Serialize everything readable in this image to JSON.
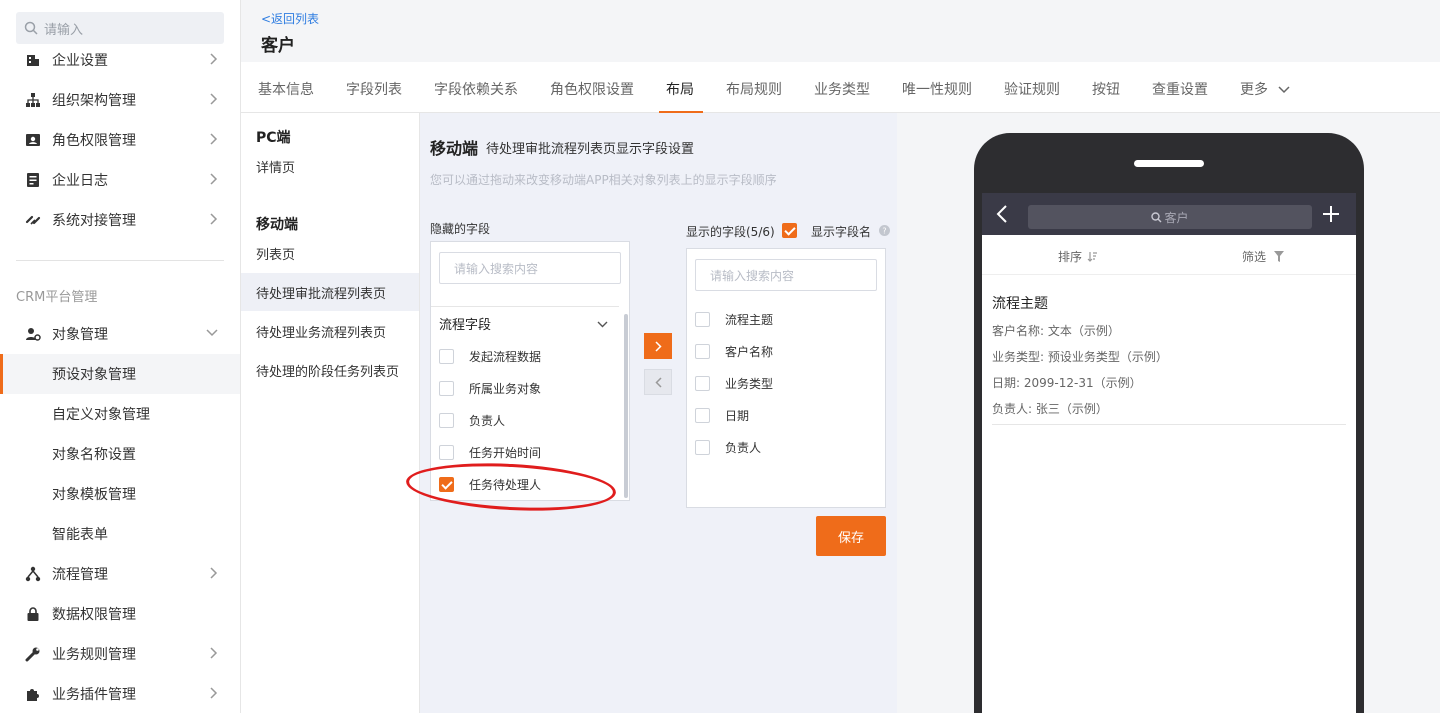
{
  "sidebar": {
    "search_placeholder": "请输入",
    "items_top": [
      {
        "label": "企业设置",
        "icon": "building-icon"
      },
      {
        "label": "组织架构管理",
        "icon": "org-chart-icon"
      },
      {
        "label": "角色权限管理",
        "icon": "id-card-icon"
      },
      {
        "label": "企业日志",
        "icon": "log-icon"
      },
      {
        "label": "系统对接管理",
        "icon": "link-icon"
      }
    ],
    "section_label": "CRM平台管理",
    "object_mgmt": "对象管理",
    "sub_items": [
      "预设对象管理",
      "自定义对象管理",
      "对象名称设置",
      "对象模板管理",
      "智能表单"
    ],
    "items_bottom": [
      {
        "label": "流程管理",
        "icon": "flow-icon"
      },
      {
        "label": "数据权限管理",
        "icon": "lock-icon"
      },
      {
        "label": "业务规则管理",
        "icon": "wrench-icon"
      },
      {
        "label": "业务插件管理",
        "icon": "puzzle-icon"
      }
    ]
  },
  "header": {
    "back_link": "<返回列表",
    "title": "客户"
  },
  "tabs": [
    "基本信息",
    "字段列表",
    "字段依赖关系",
    "角色权限设置",
    "布局",
    "布局规则",
    "业务类型",
    "唯一性规则",
    "验证规则",
    "按钮",
    "查重设置",
    "更多"
  ],
  "active_tab": "布局",
  "subnav": {
    "pc_title": "PC端",
    "pc_items": [
      "详情页"
    ],
    "mobile_title": "移动端",
    "mobile_items": [
      "列表页",
      "待处理审批流程列表页",
      "待处理业务流程列表页",
      "待处理的阶段任务列表页"
    ]
  },
  "config": {
    "title": "移动端",
    "subtitle": "待处理审批流程列表页显示字段设置",
    "hint": "您可以通过拖动来改变移动端APP相关对象列表上的显示字段顺序",
    "hidden_label": "隐藏的字段",
    "shown_label": "显示的字段(5/6)",
    "shown_name_label": "显示字段名",
    "search_placeholder": "请输入搜索内容",
    "group_label": "流程字段",
    "hidden_fields": [
      "发起流程数据",
      "所属业务对象",
      "负责人",
      "任务开始时间",
      "任务待处理人"
    ],
    "shown_fields": [
      "流程主题",
      "客户名称",
      "业务类型",
      "日期",
      "负责人"
    ],
    "save_label": "保存",
    "accent": "#ef6c1a"
  },
  "preview": {
    "search": "客户",
    "sort": "排序",
    "filter": "筛选",
    "card_title": "流程主题",
    "card_lines": [
      "客户名称: 文本（示例）",
      "业务类型: 预设业务类型（示例）",
      "日期: 2099-12-31（示例）",
      "负责人: 张三（示例）"
    ]
  }
}
